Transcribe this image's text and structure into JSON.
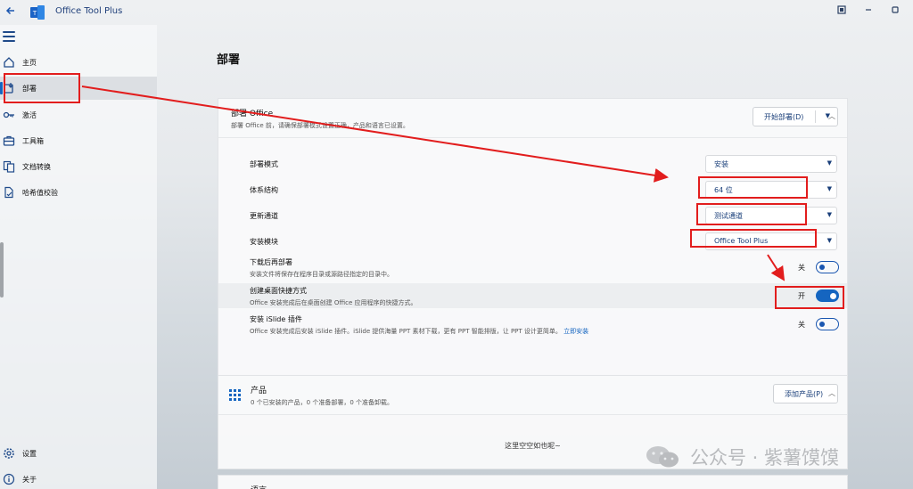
{
  "titlebar": {
    "title": "Office Tool Plus",
    "back_icon": "arrow-left-icon",
    "window_buttons": [
      "pin-icon",
      "minimize-icon",
      "maximize-icon"
    ]
  },
  "sidebar": {
    "items": [
      {
        "label": "主页",
        "icon": "home-icon"
      },
      {
        "label": "部署",
        "icon": "deploy-icon",
        "active": true
      },
      {
        "label": "激活",
        "icon": "key-icon"
      },
      {
        "label": "工具箱",
        "icon": "toolbox-icon"
      },
      {
        "label": "文档转换",
        "icon": "document-convert-icon"
      },
      {
        "label": "哈希值校验",
        "icon": "hash-check-icon"
      }
    ],
    "bottom_items": [
      {
        "label": "设置",
        "icon": "gear-icon"
      },
      {
        "label": "关于",
        "icon": "info-icon"
      }
    ]
  },
  "main": {
    "page_title": "部署",
    "deploy_card": {
      "title": "部署 Office",
      "subtitle": "部署 Office 前，请确保部署模式设置正确，产品和语言已设置。",
      "start_button": "开始部署(D)",
      "rows": {
        "mode": {
          "label": "部署模式",
          "value": "安装"
        },
        "arch": {
          "label": "体系结构",
          "value": "64 位"
        },
        "channel": {
          "label": "更新通道",
          "value": "测试通道"
        },
        "module": {
          "label": "安装模块",
          "value": "Office Tool Plus"
        },
        "download_then_deploy": {
          "label": "下载后再部署",
          "desc": "安装文件将保存在程序目录或源路径指定的目录中。",
          "state": "关",
          "on": false
        },
        "desktop_shortcut": {
          "label": "创建桌面快捷方式",
          "desc": "Office 安装完成后在桌面创建 Office 应用程序的快捷方式。",
          "state": "开",
          "on": true
        },
        "islide": {
          "label": "安装 iSlide 插件",
          "desc": "Office 安装完成后安装 iSlide 插件。iSlide 提供海量 PPT 素材下载，更有 PPT 智能排版，让 PPT 设计更简单。",
          "link": "立即安装",
          "state": "关",
          "on": false
        }
      }
    },
    "product_card": {
      "title": "产品",
      "subtitle": "0 个已安装的产品，0 个准备部署，0 个准备卸载。",
      "add_button": "添加产品(P)",
      "empty_text": "这里空空如也呢~"
    },
    "language_card": {
      "title": "语言"
    }
  },
  "watermark": {
    "text": "公众号 · 紫薯馍馍"
  },
  "colors": {
    "accent": "#1565c0",
    "annotation": "#e21d1d"
  }
}
